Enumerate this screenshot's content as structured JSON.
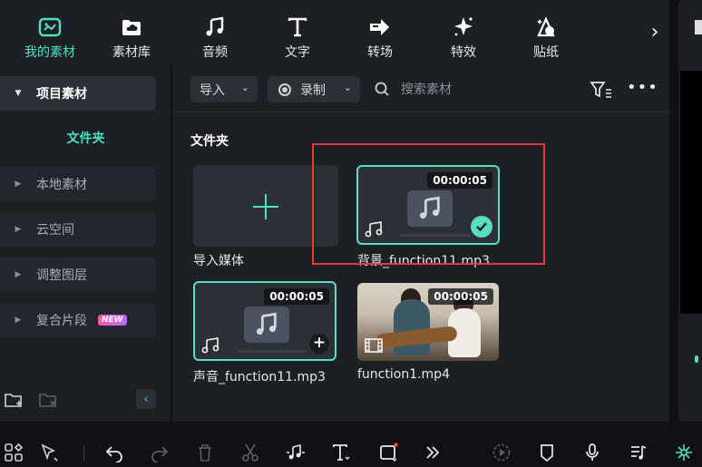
{
  "tabs": [
    {
      "label": "我的素材",
      "icon": "my-media-icon",
      "active": true
    },
    {
      "label": "素材库",
      "icon": "media-library-icon",
      "active": false
    },
    {
      "label": "音频",
      "icon": "music-note-icon",
      "active": false
    },
    {
      "label": "文字",
      "icon": "text-t-icon",
      "active": false
    },
    {
      "label": "转场",
      "icon": "transition-icon",
      "active": false
    },
    {
      "label": "特效",
      "icon": "effects-sparkle-icon",
      "active": false
    },
    {
      "label": "贴纸",
      "icon": "sticker-icon",
      "active": false
    }
  ],
  "tabs_more": "›",
  "sidebar": {
    "project_media": "项目素材",
    "folder": "文件夹",
    "items": [
      {
        "label": "本地素材"
      },
      {
        "label": "云空间"
      },
      {
        "label": "调整图层"
      },
      {
        "label": "复合片段",
        "badge": "NEW"
      }
    ],
    "collapse": "‹"
  },
  "toolbar": {
    "import_label": "导入",
    "record_label": "录制",
    "search_placeholder": "搜索素材",
    "more_label": "•••"
  },
  "content": {
    "section_title": "文件夹",
    "import_media_label": "导入媒体",
    "items": [
      {
        "name": "背景_function11.mp3",
        "duration": "00:00:05",
        "type": "audio",
        "selected": true
      },
      {
        "name": "声音_function11.mp3",
        "duration": "00:00:05",
        "type": "audio",
        "selected": true
      },
      {
        "name": "function1.mp4",
        "duration": "00:00:05",
        "type": "video",
        "selected": false
      }
    ]
  },
  "colors": {
    "accent": "#4fe0bf",
    "panel": "#1c1f24",
    "background": "#0f1114",
    "highlight_box": "#e03a3a"
  }
}
